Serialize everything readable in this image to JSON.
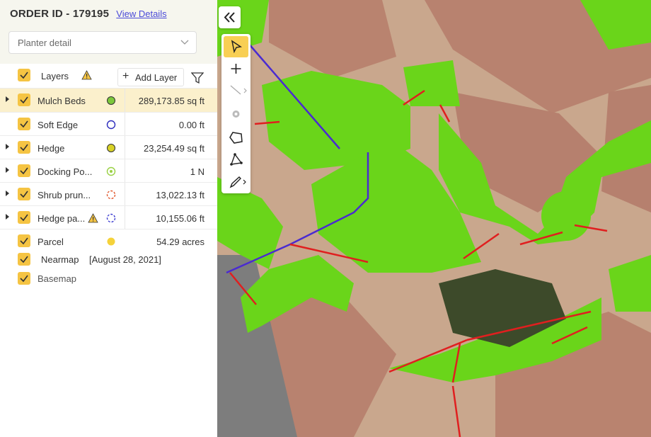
{
  "header": {
    "order_id": "ORDER ID - 179195",
    "view_details": "View Details"
  },
  "select": {
    "value": "Planter detail"
  },
  "layers": {
    "title": "Layers",
    "add_layer": "Add Layer"
  },
  "rows": [
    {
      "name": "Mulch Beds",
      "value": "289,173.85  sq ft",
      "symbol": "filled-dot",
      "color": "#7cc83b"
    },
    {
      "name": "Soft Edge",
      "value": "0.00  ft",
      "symbol": "ring",
      "color": "#2d2dbd"
    },
    {
      "name": "Hedge",
      "value": "23,254.49  sq ft",
      "symbol": "filled-dot",
      "color": "#d8d227"
    },
    {
      "name": "Docking Po...",
      "value": "1 N",
      "symbol": "ring-dot",
      "color": "#9ad145"
    },
    {
      "name": "Shrub prun...",
      "value": "13,022.13  ft",
      "symbol": "dashed-ring",
      "color": "#e0552a"
    },
    {
      "name": "Hedge pa...",
      "value": "10,155.06  ft",
      "symbol": "dashed-ring",
      "color": "#3b3bd0"
    },
    {
      "name": "Parcel",
      "value": "54.29 acres",
      "symbol": "filled-dot",
      "color": "#f5d23a"
    }
  ],
  "nearmap": {
    "name": "Nearmap",
    "date": "[August 28, 2021]"
  },
  "basemap": {
    "name": "Basemap"
  },
  "colors": {
    "accent": "#f5c443",
    "active_row": "#fbf0cc",
    "link": "#4a4ad8",
    "mulch_green": "#6ad51a"
  }
}
